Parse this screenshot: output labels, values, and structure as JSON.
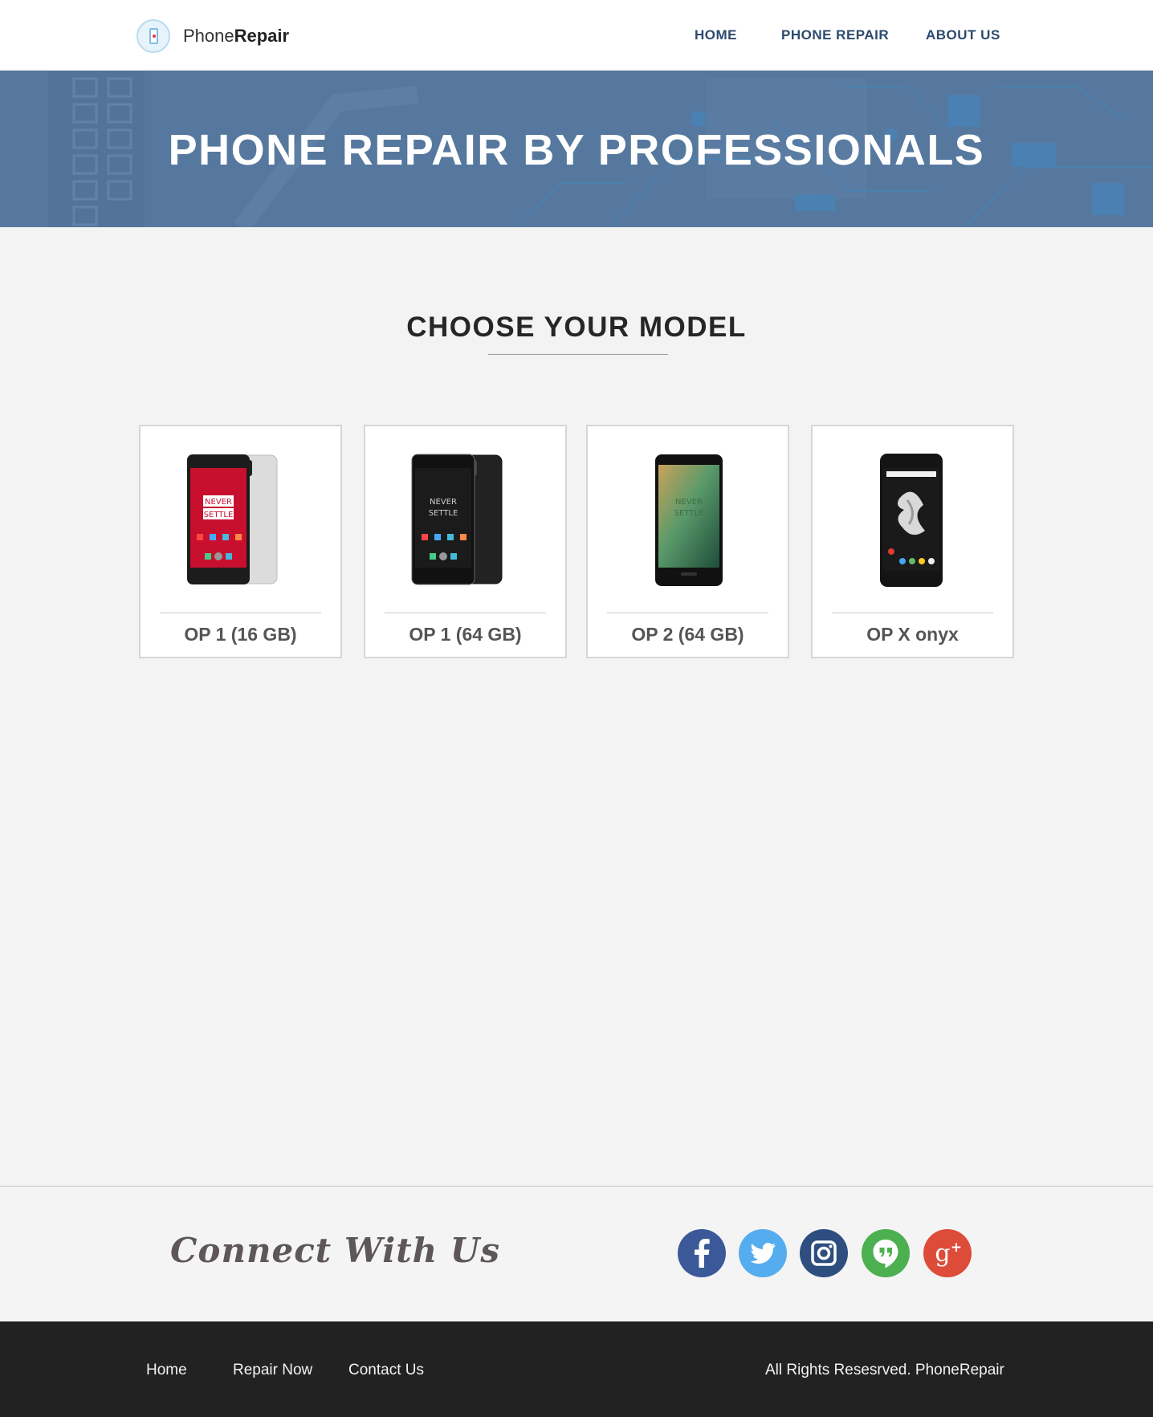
{
  "brand": {
    "name_light": "Phone",
    "name_bold": "Repair"
  },
  "nav": {
    "home": "HOME",
    "phone_repair": "PHONE REPAIR",
    "about_us": "ABOUT US"
  },
  "hero": {
    "title": "PHONE REPAIR BY PROFESSIONALS"
  },
  "models": {
    "title": "CHOOSE YOUR MODEL",
    "items": [
      {
        "label": "OP 1 (16 GB)",
        "screen_line1": "NEVER",
        "screen_line2": "SETTLE"
      },
      {
        "label": "OP 1 (64 GB)",
        "screen_line1": "NEVER",
        "screen_line2": "SETTLE"
      },
      {
        "label": "OP 2 (64 GB)",
        "screen_line1": "NEVER",
        "screen_line2": "SETTLE"
      },
      {
        "label": "OP X onyx"
      }
    ]
  },
  "connect": {
    "title": "Connect With Us"
  },
  "social": [
    {
      "icon": "facebook-icon",
      "color": "#3b5998"
    },
    {
      "icon": "twitter-icon",
      "color": "#55acee"
    },
    {
      "icon": "instagram-icon",
      "color": "#2d4e7e"
    },
    {
      "icon": "hangouts-icon",
      "color": "#4caf50"
    },
    {
      "icon": "google-plus-icon",
      "color": "#dd4b39"
    }
  ],
  "footer": {
    "home": "Home",
    "repair_now": "Repair Now",
    "contact_us": "Contact Us",
    "copyright": "All Rights Resesrved. PhoneRepair"
  }
}
